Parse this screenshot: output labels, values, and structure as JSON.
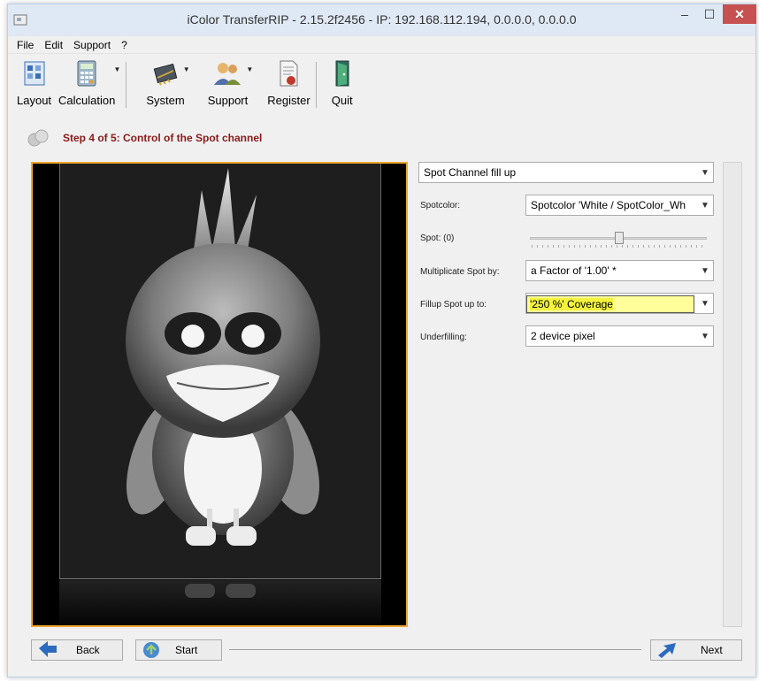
{
  "window": {
    "title": "iColor TransferRIP - 2.15.2f2456 - IP: 192.168.112.194, 0.0.0.0, 0.0.0.0",
    "minimize": "–",
    "maximize": "☐",
    "close": "✕"
  },
  "menu": [
    "File",
    "Edit",
    "Support",
    "?"
  ],
  "toolbar": {
    "layout": "Layout",
    "calculation": "Calculation",
    "system": "System",
    "support": "Support",
    "register": "Register",
    "quit": "Quit"
  },
  "step": {
    "title": "Step 4 of 5: Control of the Spot channel"
  },
  "panel": {
    "mode": "Spot Channel fill up",
    "spotcolor_label": "Spotcolor:",
    "spotcolor_value": "Spotcolor 'White / SpotColor_Wh",
    "spot_label": "Spot: (0)",
    "multiplicate_label": "Multiplicate Spot by:",
    "multiplicate_value": "a Factor of '1.00' *",
    "fillup_label": "Fillup Spot up to:",
    "fillup_value": "'250 %' Coverage",
    "underfilling_label": "Underfilling:",
    "underfilling_value": "2 device pixel"
  },
  "buttons": {
    "back": "Back",
    "start": "Start",
    "next": "Next"
  },
  "colors": {
    "step_title": "#8b1a1a",
    "preview_border": "#f0a730",
    "highlight": "#f3f23d",
    "close_button": "#c75050"
  },
  "icons": [
    "app-icon",
    "layout-icon",
    "calculator-icon",
    "system-chip-icon",
    "support-people-icon",
    "register-certificate-icon",
    "quit-door-icon",
    "step-spheres-icon",
    "back-arrow-icon",
    "start-icon",
    "next-arrow-icon"
  ]
}
